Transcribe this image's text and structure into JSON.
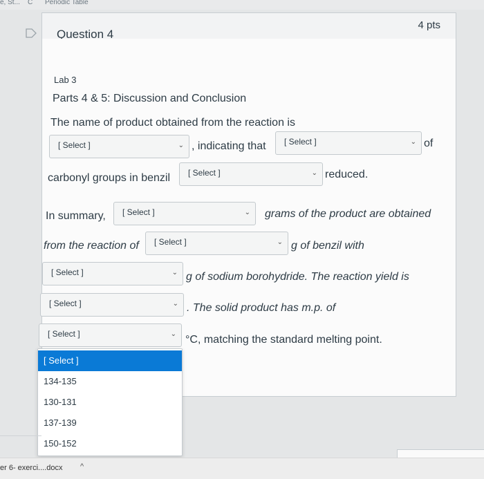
{
  "browser": {
    "tab1": "e, St...",
    "tab2": "C",
    "tab3": "Periodic Table"
  },
  "question": {
    "title": "Question 4",
    "points": "4 pts"
  },
  "body": {
    "lab": "Lab 3",
    "parts": "Parts 4 & 5: Discussion and Conclusion",
    "line1": "The name of product obtained from the reaction is",
    "indicating": ", indicating that",
    "of": "of",
    "carbonyl": "carbonyl groups in benzil",
    "reduced": "reduced.",
    "in_summary": "In summary,",
    "grams": "grams of the product are obtained",
    "from_reaction": "from the reaction of",
    "benzil_with": "g of benzil with",
    "sodium": "g of sodium borohydride. The reaction yield is",
    "mp": ". The solid product has m.p. of",
    "matching": "°C, matching the standard melting point."
  },
  "select_placeholder": "[ Select ]",
  "dropdown": {
    "options": [
      "[ Select ]",
      "134-135",
      "130-131",
      "137-139",
      "150-152"
    ],
    "active_color": "#0a7ad6"
  },
  "bottom": {
    "filename": "er 6- exerci....docx",
    "chevron": "^"
  }
}
